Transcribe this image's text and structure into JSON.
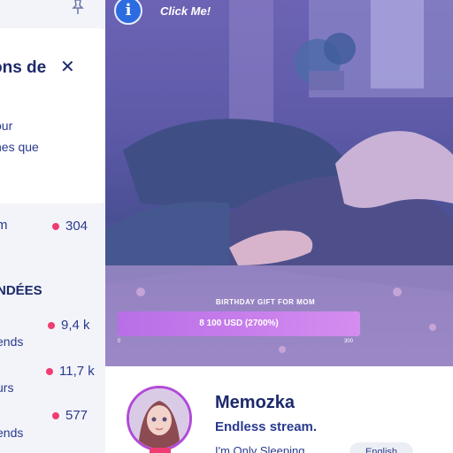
{
  "sidebar": {
    "panel": {
      "title": "ons de",
      "close_icon": "close-icon",
      "line1": "our",
      "line2": "nes que"
    },
    "top_row": {
      "label": "m",
      "count": "304"
    },
    "section_heading": "NDÉES",
    "items": [
      {
        "label": "ends",
        "count": "9,4 k"
      },
      {
        "label": "urs",
        "count": "11,7 k"
      },
      {
        "label": "ends",
        "count": "577"
      }
    ]
  },
  "stream": {
    "info_icon": "info-icon",
    "info_label": "i",
    "click_me": "Click Me!",
    "goal": {
      "title": "BIRTHDAY GIFT FOR MOM",
      "amount_text": "8 100 USD (2700%)",
      "progress_fraction": 1.0,
      "min_label": "0",
      "max_label": "300"
    }
  },
  "profile": {
    "name": "Memozka",
    "subtitle": "Endless stream.",
    "description": "I'm Only Sleeping",
    "language": "English"
  },
  "colors": {
    "accent_pink": "#ef3c72",
    "navy": "#1c2a6b",
    "info_blue": "#2b6de0",
    "goal_purple": "#b86ee6"
  }
}
